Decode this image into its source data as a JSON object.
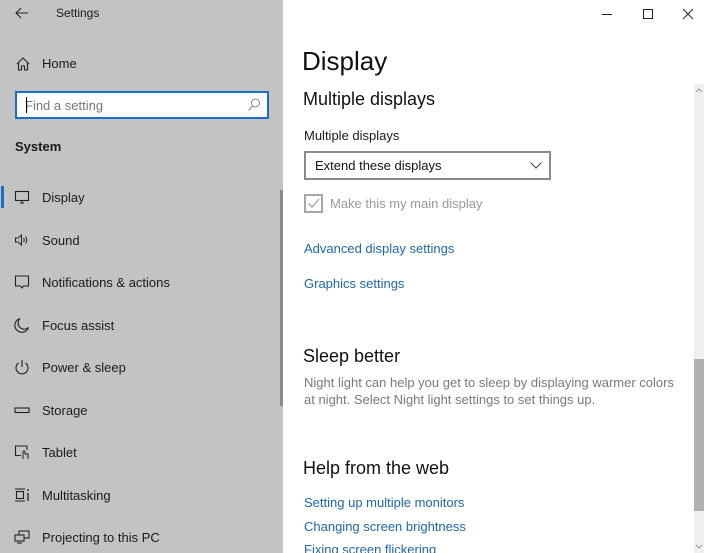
{
  "window": {
    "title": "Settings",
    "controls": {
      "minimize": "minimize",
      "maximize": "maximize",
      "close": "close"
    }
  },
  "sidebar": {
    "home_label": "Home",
    "search": {
      "placeholder": "Find a setting",
      "value": ""
    },
    "section_title": "System",
    "items": [
      {
        "label": "Display",
        "icon": "monitor-icon",
        "active": true
      },
      {
        "label": "Sound",
        "icon": "speaker-icon",
        "active": false
      },
      {
        "label": "Notifications & actions",
        "icon": "notification-icon",
        "active": false
      },
      {
        "label": "Focus assist",
        "icon": "moon-icon",
        "active": false
      },
      {
        "label": "Power & sleep",
        "icon": "power-icon",
        "active": false
      },
      {
        "label": "Storage",
        "icon": "storage-icon",
        "active": false
      },
      {
        "label": "Tablet",
        "icon": "tablet-icon",
        "active": false
      },
      {
        "label": "Multitasking",
        "icon": "multitasking-icon",
        "active": false
      },
      {
        "label": "Projecting to this PC",
        "icon": "projecting-icon",
        "active": false
      }
    ]
  },
  "main": {
    "page_title": "Display",
    "multiple_displays": {
      "heading": "Multiple displays",
      "field_label": "Multiple displays",
      "dropdown_value": "Extend these displays",
      "checkbox_label": "Make this my main display",
      "checkbox_checked": true,
      "checkbox_disabled": true,
      "links": [
        "Advanced display settings",
        "Graphics settings"
      ]
    },
    "sleep_better": {
      "heading": "Sleep better",
      "description": "Night light can help you get to sleep by displaying warmer colors at night. Select Night light settings to set things up."
    },
    "help": {
      "heading": "Help from the web",
      "links": [
        "Setting up multiple monitors",
        "Changing screen brightness",
        "Fixing screen flickering"
      ]
    }
  },
  "colors": {
    "accent": "#1a6fc4",
    "link": "#1f67a8",
    "sidebar_bg": "#c3c3c3",
    "disabled_text": "#9a9a9a"
  }
}
